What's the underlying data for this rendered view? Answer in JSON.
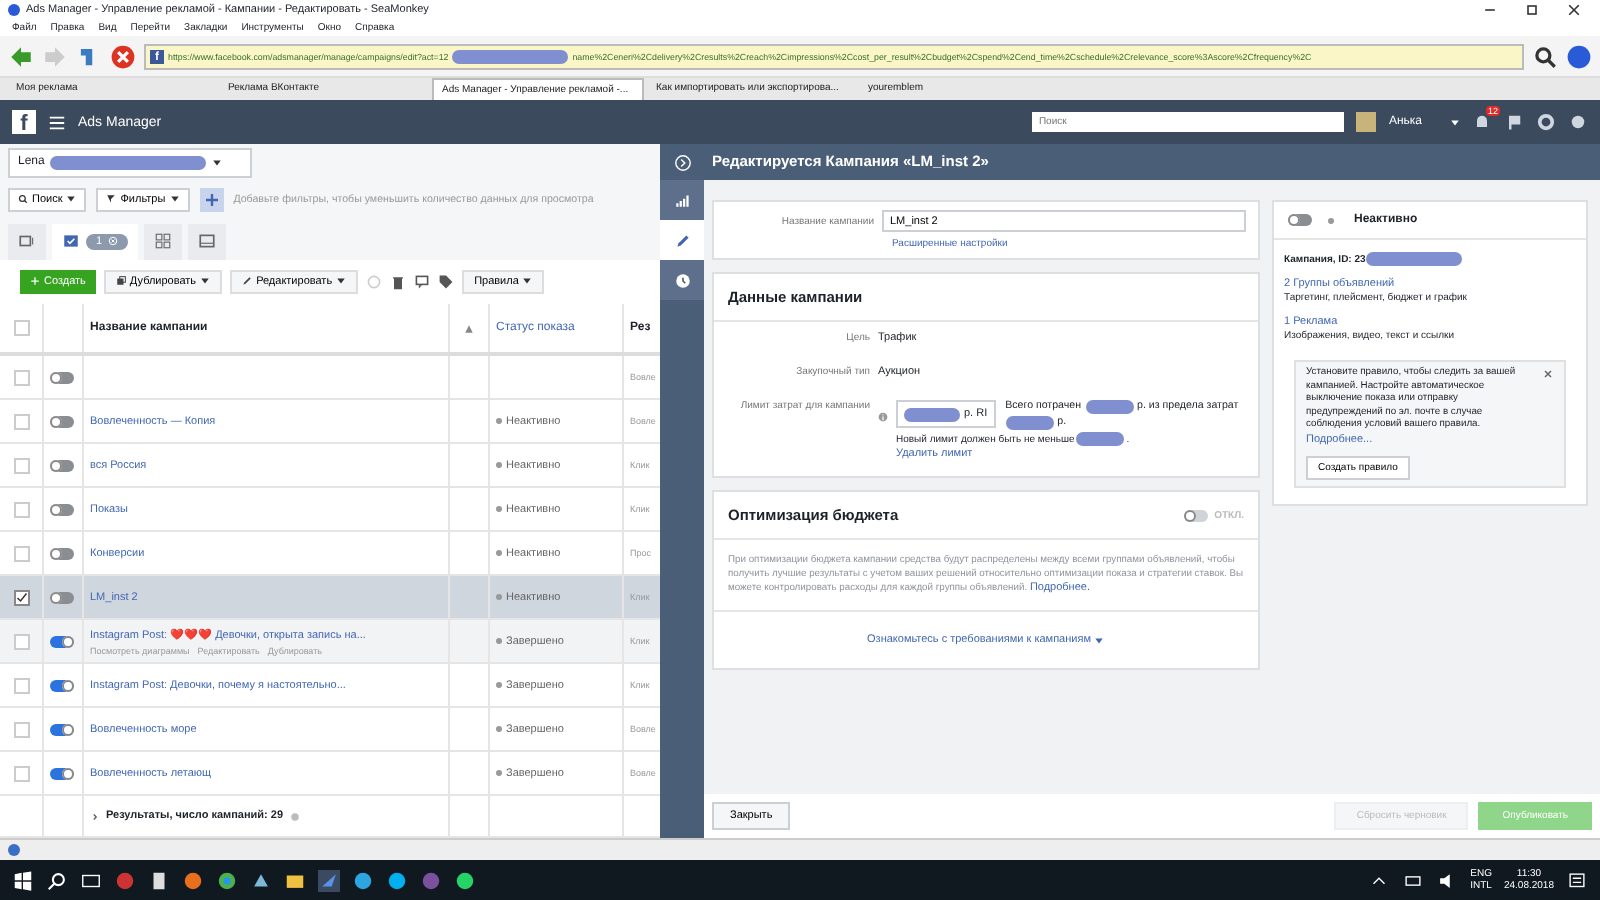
{
  "browser": {
    "title": "Ads Manager - Управление рекламой - Кампании - Редактировать - SeaMonkey",
    "menu": [
      "Файл",
      "Правка",
      "Вид",
      "Перейти",
      "Закладки",
      "Инструменты",
      "Окно",
      "Справка"
    ],
    "site_icon": "f",
    "url_start": "https://www.facebook.com/adsmanager/manage/campaigns/edit?act=12",
    "url_end": "name%2Ceneri%2Cdelivery%2Cresults%2Creach%2Cimpressions%2Ccost_per_result%2Cbudget%2Cspend%2Cend_time%2Cschedule%2Crelevance_score%3Ascore%2Cfrequency%2C",
    "tabs": [
      {
        "label": "Моя реклама",
        "selected": false
      },
      {
        "label": "Реклама ВКонтакте",
        "selected": false
      },
      {
        "label": "Ads Manager - Управление рекламой -...",
        "selected": true
      },
      {
        "label": "Как импортировать или экспортирова...",
        "selected": false
      },
      {
        "label": "youremblem",
        "selected": false
      }
    ]
  },
  "header": {
    "logo": "f",
    "app": "Ads Manager",
    "search_placeholder": "Поиск",
    "user": "Анька",
    "notifications": "12"
  },
  "account": {
    "name": "Lena"
  },
  "filters": {
    "search": "Поиск",
    "filters": "Фильтры",
    "hint": "Добавьте фильтры, чтобы уменьшить количество данных для просмотра"
  },
  "view_tabs": [
    {
      "kind": "account",
      "selected": false
    },
    {
      "kind": "campaigns",
      "selected": true,
      "count": "1"
    },
    {
      "kind": "adsets",
      "selected": false
    },
    {
      "kind": "ads",
      "selected": false
    }
  ],
  "toolbar": {
    "create": "Создать",
    "duplicate": "Дублировать",
    "edit": "Редактировать",
    "rules": "Правила"
  },
  "table": {
    "columns": [
      "Название кампании",
      "Статус показа",
      "Рез"
    ],
    "all_selected": false,
    "rows": [
      {
        "on": false,
        "selected": false,
        "result": "Вовле"
      },
      {
        "name": "Вовлеченность — Копия",
        "on": false,
        "selected": false,
        "status": "Неактивно",
        "result": "Вовле"
      },
      {
        "name": "вся Россия",
        "on": false,
        "selected": false,
        "status": "Неактивно",
        "result": "Клик"
      },
      {
        "name": "Показы",
        "on": false,
        "selected": false,
        "status": "Неактивно",
        "result": "Клик"
      },
      {
        "name": "Конверсии",
        "on": false,
        "selected": false,
        "status": "Неактивно",
        "result": "Прос"
      },
      {
        "name": "LM_inst 2",
        "on": false,
        "selected": true,
        "status": "Неактивно",
        "result": "Клик"
      },
      {
        "name": "Instagram Post: ❤️❤️❤️ Девочки, открыта запись на...",
        "on": true,
        "selected": false,
        "status": "Завершено",
        "result": "Клик",
        "actions": [
          "Посмотреть диаграммы",
          "Редактировать",
          "Дублировать"
        ]
      },
      {
        "name": "Instagram Post: Девочки, почему я настоятельно...",
        "on": true,
        "selected": false,
        "status": "Завершено",
        "result": "Клик"
      },
      {
        "name": "Вовлеченность море",
        "on": true,
        "selected": false,
        "status": "Завершено",
        "result": "Вовле"
      },
      {
        "name": "Вовлеченность летающ",
        "on": true,
        "selected": false,
        "status": "Завершено",
        "result": "Вовле"
      }
    ],
    "summary": "Результаты, число кампаний: 29"
  },
  "editor": {
    "title": "Редактируется Кампания «LM_inst 2»",
    "name_label": "Название кампании",
    "name_value": "LM_inst 2",
    "advanced": "Расширенные настройки",
    "data_title": "Данные кампании",
    "fields": [
      {
        "label": "Цель",
        "value": "Трафик"
      },
      {
        "label": "Закупочный тип",
        "value": "Аукцион"
      }
    ],
    "limit_label": "Лимит затрат для кампании",
    "currency": "р. RI",
    "spent": "Всего потрачен",
    "spent_of": "р. из предела затрат",
    "spent_end": "р.",
    "min_note": "Новый лимит должен быть не меньше",
    "min_end": ".",
    "remove": "Удалить лимит",
    "budget_title": "Оптимизация бюджета",
    "budget_on": false,
    "budget_state": "ОТКЛ.",
    "budget_text": "При оптимизации бюджета кампании средства будут распределены между всеми группами объявлений, чтобы получить лучшие результаты с учетом ваших решений относительно оптимизации показа и стратегии ставок. Вы можете контролировать расходы для каждой группы объявлений.",
    "budget_link": "Подробнее.",
    "requirements": "Ознакомьтесь с требованиями к кампаниям",
    "close": "Закрыть",
    "reset": "Сбросить черновик",
    "publish": "Опубликовать"
  },
  "summary_card": {
    "on": false,
    "status": "Неактивно",
    "id": "Кампания, ID: 23",
    "links": [
      {
        "title": "2 Группы объявлений",
        "desc": "Таргетинг, плейсмент, бюджет и график"
      },
      {
        "title": "1 Реклама",
        "desc": "Изображения, видео, текст и ссылки"
      }
    ],
    "tip": "Установите правило, чтобы следить за вашей кампанией. Настройте автоматическое выключение показа или отправку предупреждений по эл. почте в случае соблюдения условий вашего правила.",
    "tip_link": "Подробнее...",
    "tip_button": "Создать правило"
  },
  "taskbar": {
    "lang": "ENG",
    "layout": "INTL",
    "time": "11:30",
    "date": "24.08.2018"
  }
}
